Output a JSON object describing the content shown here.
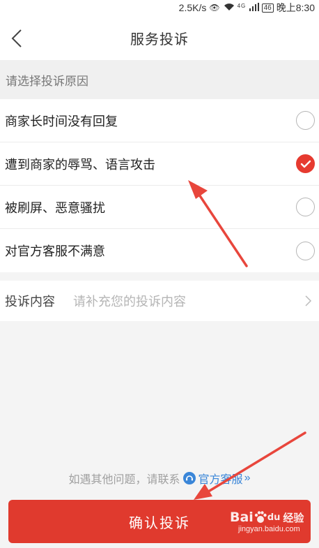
{
  "status_bar": {
    "speed": "2.5K/s",
    "network": "4G",
    "battery": "46",
    "time": "晚上8:30"
  },
  "nav": {
    "title": "服务投诉"
  },
  "reasons_header": "请选择投诉原因",
  "reasons": [
    {
      "label": "商家长时间没有回复",
      "checked": false
    },
    {
      "label": "遭到商家的辱骂、语言攻击",
      "checked": true
    },
    {
      "label": "被刷屏、恶意骚扰",
      "checked": false
    },
    {
      "label": "对官方客服不满意",
      "checked": false
    }
  ],
  "content": {
    "label": "投诉内容",
    "placeholder": "请补充您的投诉内容"
  },
  "help": {
    "text": "如遇其他问题，请联系",
    "link": "官方客服",
    "link_suffix": "»"
  },
  "confirm_label": "确认投诉",
  "watermark": {
    "brand_left": "Bai",
    "brand_right": "du",
    "cn": "经验",
    "url": "jingyan.baidu.com"
  },
  "colors": {
    "accent": "#e03a2e",
    "link": "#3a86d8",
    "annotation_arrow": "#e8463c"
  }
}
